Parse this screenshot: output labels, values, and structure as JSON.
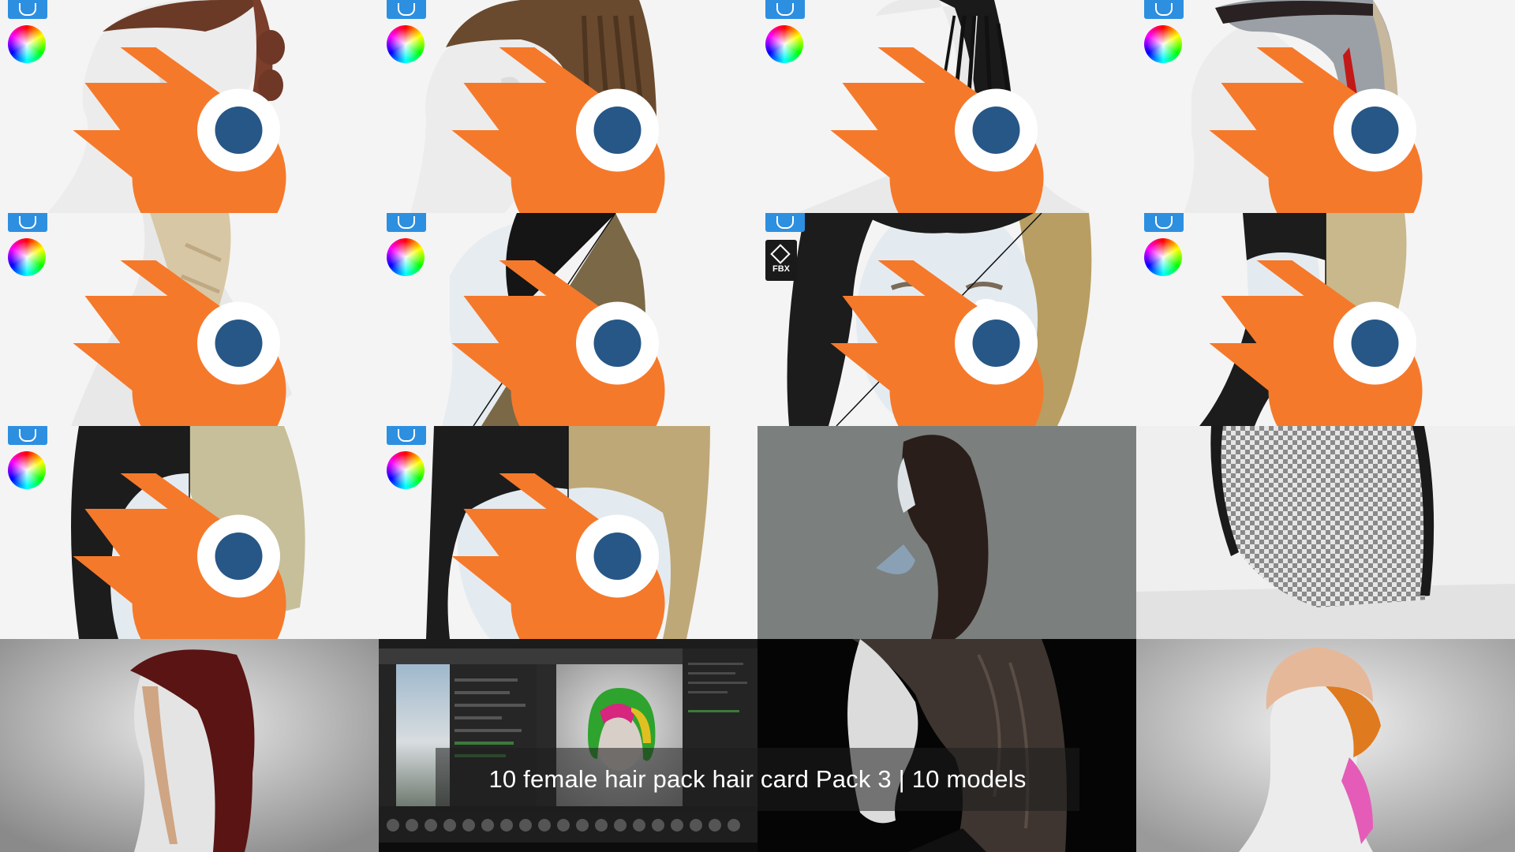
{
  "title": "10 female hair pack hair card Pack 3 | 10 models",
  "badges": {
    "unreal": "unreal-engine-icon",
    "color": "color-wheel-icon",
    "blender": "blender-icon",
    "fbx_label": "FBX"
  },
  "colors": {
    "unreal_blue": "#2d8fe0",
    "blender_orange": "#f5792a",
    "blender_blue": "#265787",
    "tile_bg_light": "#f3f3f3",
    "tile_bg_gray": "#7b7f7d"
  }
}
